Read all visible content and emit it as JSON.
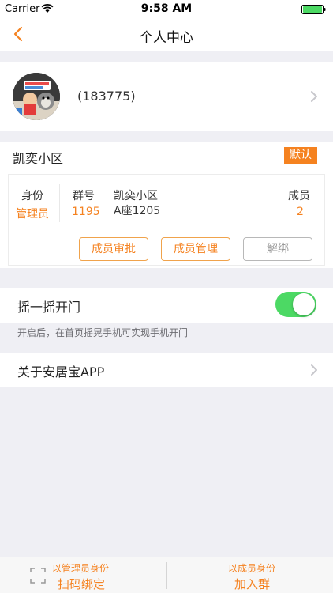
{
  "status_bar": {
    "carrier": "Carrier",
    "time": "9:58 AM"
  },
  "nav": {
    "title": "个人中心"
  },
  "profile": {
    "user_id": "(183775)"
  },
  "community": {
    "name": "凯奕小区",
    "default_badge": "默认",
    "identity_label": "身份",
    "identity_value": "管理员",
    "group_label": "群号",
    "group_value": "1195",
    "address_line1": "凯奕小区",
    "address_line2": "A座1205",
    "members_label": "成员",
    "members_value": "2",
    "buttons": {
      "approve": "成员审批",
      "manage": "成员管理",
      "unbind": "解绑"
    }
  },
  "shake_open": {
    "label": "摇一摇开门",
    "enabled": true,
    "hint": "开启后，在首页摇晃手机可实现手机开门"
  },
  "about": {
    "label": "关于安居宝APP"
  },
  "bottom_bar": {
    "left_small": "以管理员身份",
    "left_big": "扫码绑定",
    "right_small": "以成员身份",
    "right_big": "加入群"
  },
  "colors": {
    "accent": "#f58220",
    "toggle_on": "#4cd964",
    "background": "#efeff4"
  }
}
